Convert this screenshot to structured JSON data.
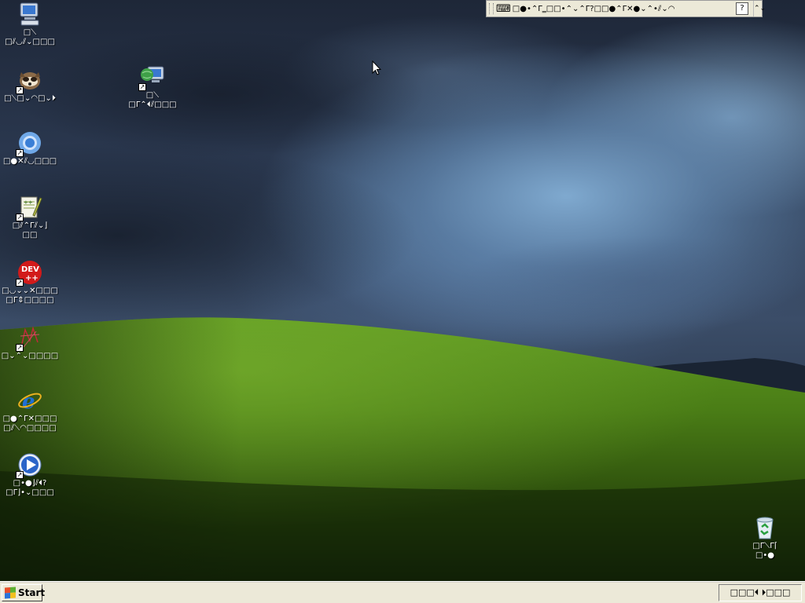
{
  "colors": {
    "taskbar": "#ece9d8",
    "sky_dark": "#1e2738",
    "grass": "#4f8a18",
    "icon_label_text": "#ffffff"
  },
  "language_bar": {
    "keyboard_icon": "keyboard-icon",
    "text": "□●•⌃Γ‗□□•⌃⌄⌃Γ?□□●⌃Γ✕●⌄⌃•⫽⌄◠",
    "help_label": "?",
    "minimize_label": "⌃⌄"
  },
  "desktop_icons": [
    {
      "name": "my-computer",
      "icon": "computer-icon",
      "label_line1": "□⫽◡⫽⌄□□□",
      "label_line0": "□⟍"
    },
    {
      "name": "raccoon-app",
      "icon": "raccoon-icon",
      "label_line1": "□⟍□⌄◠□⌄⏵"
    },
    {
      "name": "chrome",
      "icon": "chrome-icon",
      "label_line1": "□●✕⫽◡□□□"
    },
    {
      "name": "notepad-plus-plus",
      "icon": "notepad-plus-plus-icon",
      "label_line1": "□⫽⌃Γ⫽⌄⌋",
      "label_line2": "□□"
    },
    {
      "name": "dev-cpp",
      "icon": "dev-cpp-icon",
      "label_line1": "□◡⌄⌄✕□□□",
      "label_line2": "□Γ⇕□□□□"
    },
    {
      "name": "unknown-app",
      "icon": "red-sketch-icon",
      "label_line1": "□⌄⌃⌄□□□□"
    },
    {
      "name": "internet-explorer",
      "icon": "internet-explorer-icon",
      "label_line1": "□●⌃Γ✕□□□",
      "label_line2": "□⫽⟍◠□□□□"
    },
    {
      "name": "media-player",
      "icon": "media-player-icon",
      "label_line1": "□•●⌋⫽⏴?",
      "label_line2": "□Γ⌋•⌄□□□"
    },
    {
      "name": "network",
      "icon": "network-icon",
      "label_line0": "□⟍",
      "label_line1": "□Γ⌃⏴⫽□□□"
    },
    {
      "name": "recycle-bin",
      "icon": "recycle-bin-icon",
      "label_line1": "□Γ⟍Γ⌈",
      "label_line2": "□•●"
    }
  ],
  "taskbar": {
    "start_label": "Start",
    "tray_text": "□□□⏴ ⏵□□□"
  }
}
